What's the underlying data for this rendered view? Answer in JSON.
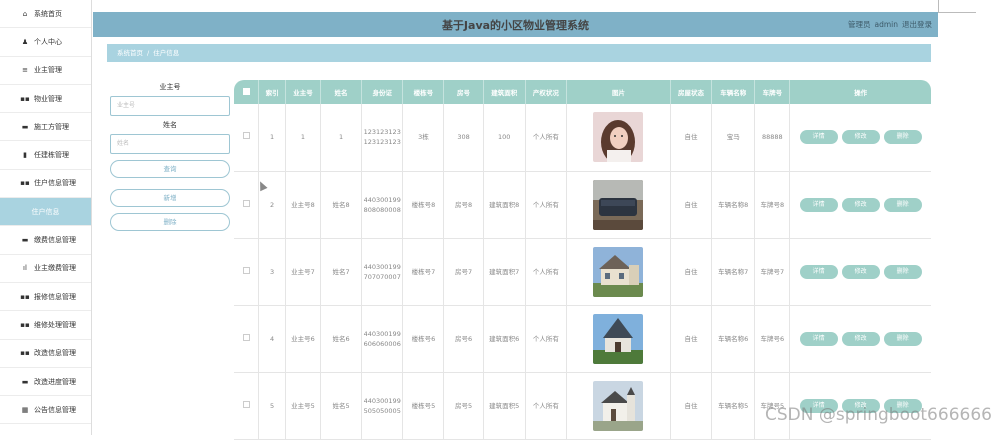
{
  "sidebar": {
    "items": [
      {
        "label": "系统首页",
        "icon": "home-icon",
        "glyph": "⌂"
      },
      {
        "label": "个人中心",
        "icon": "user-icon",
        "glyph": "♟"
      },
      {
        "label": "业主管理",
        "icon": "list-icon",
        "glyph": "≡"
      },
      {
        "label": "物业管理",
        "icon": "grid-icon",
        "glyph": "▪▪"
      },
      {
        "label": "施工方管理",
        "icon": "chat-icon",
        "glyph": "▬"
      },
      {
        "label": "任建栋管理",
        "icon": "clipboard-icon",
        "glyph": "▮"
      },
      {
        "label": "住户信息管理",
        "icon": "grid-icon",
        "glyph": "▪▪"
      },
      {
        "label": "住户信息",
        "icon": "",
        "glyph": ""
      },
      {
        "label": "缴费信息管理",
        "icon": "ticket-icon",
        "glyph": "▬"
      },
      {
        "label": "业主缴费管理",
        "icon": "bar-chart-icon",
        "glyph": "ıl"
      },
      {
        "label": "报修信息管理",
        "icon": "grid-icon",
        "glyph": "▪▪"
      },
      {
        "label": "维修处理管理",
        "icon": "grid-icon",
        "glyph": "▪▪"
      },
      {
        "label": "改造信息管理",
        "icon": "grid-icon",
        "glyph": "▪▪"
      },
      {
        "label": "改造进度管理",
        "icon": "database-icon",
        "glyph": "▬"
      },
      {
        "label": "公告信息管理",
        "icon": "apps-icon",
        "glyph": "▦"
      }
    ],
    "active_index": 7
  },
  "header": {
    "title": "基于Java的小区物业管理系统",
    "role": "管理员",
    "username": "admin",
    "logout": "退出登录"
  },
  "breadcrumb": {
    "home": "系统首页",
    "sep": "/",
    "current": "住户信息"
  },
  "search": {
    "owner_label": "业主号",
    "owner_placeholder": "业主号",
    "name_label": "姓名",
    "name_placeholder": "姓名",
    "query_btn": "查询",
    "add_btn": "新增",
    "delete_btn": "删除"
  },
  "table": {
    "headers": [
      "索引",
      "业主号",
      "姓名",
      "身份证",
      "楼栋号",
      "房号",
      "建筑面积",
      "产权状况",
      "图片",
      "房屋状态",
      "车辆名称",
      "车牌号",
      "操作"
    ],
    "rows": [
      {
        "index": "1",
        "owner": "1",
        "name": "1",
        "id": "123123123123123123",
        "building": "3栋",
        "room": "308",
        "area": "100",
        "property": "个人所有",
        "pic": "portrait",
        "status": "自住",
        "car": "宝马",
        "plate": "88888"
      },
      {
        "index": "2",
        "owner": "业主号8",
        "name": "姓名8",
        "id": "440300199808080008",
        "building": "楼栋号8",
        "room": "房号8",
        "area": "建筑面积8",
        "property": "个人所有",
        "pic": "patio",
        "status": "自住",
        "car": "车辆名称8",
        "plate": "车牌号8"
      },
      {
        "index": "3",
        "owner": "业主号7",
        "name": "姓名7",
        "id": "440300199707070007",
        "building": "楼栋号7",
        "room": "房号7",
        "area": "建筑面积7",
        "property": "个人所有",
        "pic": "house",
        "status": "自住",
        "car": "车辆名称7",
        "plate": "车牌号7"
      },
      {
        "index": "4",
        "owner": "业主号6",
        "name": "姓名6",
        "id": "440300199606060006",
        "building": "楼栋号6",
        "room": "房号6",
        "area": "建筑面积6",
        "property": "个人所有",
        "pic": "chapel",
        "status": "自住",
        "car": "车辆名称6",
        "plate": "车牌号6"
      },
      {
        "index": "5",
        "owner": "业主号5",
        "name": "姓名5",
        "id": "440300199505050005",
        "building": "楼栋号5",
        "room": "房号5",
        "area": "建筑面积5",
        "property": "个人所有",
        "pic": "church",
        "status": "自住",
        "car": "车辆名称5",
        "plate": "车牌号5"
      }
    ],
    "actions": {
      "detail": "详情",
      "edit": "修改",
      "delete": "删除"
    }
  },
  "watermark": "CSDN @springboot666666",
  "colors": {
    "header": "#7fb1c7",
    "crumb": "#a9d3e0",
    "table_head": "#9fd0c8",
    "button": "#9fd0c8"
  }
}
